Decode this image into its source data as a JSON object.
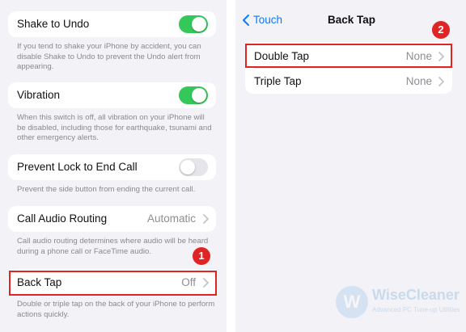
{
  "left": {
    "shake": {
      "label": "Shake to Undo",
      "on": true,
      "note": "If you tend to shake your iPhone by accident, you can disable Shake to Undo to prevent the Undo alert from appearing."
    },
    "vibration": {
      "label": "Vibration",
      "on": true,
      "note": "When this switch is off, all vibration on your iPhone will be disabled, including those for earthquake, tsunami and other emergency alerts."
    },
    "prevent_lock": {
      "label": "Prevent Lock to End Call",
      "on": false,
      "note": "Prevent the side button from ending the current call."
    },
    "call_audio": {
      "label": "Call Audio Routing",
      "value": "Automatic",
      "note": "Call audio routing determines where audio will be heard during a phone call or FaceTime audio."
    },
    "back_tap": {
      "label": "Back Tap",
      "value": "Off",
      "note": "Double or triple tap on the back of your iPhone to perform actions quickly."
    },
    "badge": "1"
  },
  "right": {
    "nav": {
      "back_label": "Touch",
      "title": "Back Tap"
    },
    "double_tap": {
      "label": "Double Tap",
      "value": "None"
    },
    "triple_tap": {
      "label": "Triple Tap",
      "value": "None"
    },
    "badge": "2"
  },
  "watermark": {
    "logo_letter": "W",
    "name": "WiseCleaner",
    "tagline": "Advanced PC Tune-up Utilities"
  },
  "colors": {
    "toggle_on": "#34c759",
    "toggle_off": "#e5e5ea",
    "highlight": "#e02424",
    "ios_blue": "#0a7aff",
    "background": "#f2f2f7"
  }
}
